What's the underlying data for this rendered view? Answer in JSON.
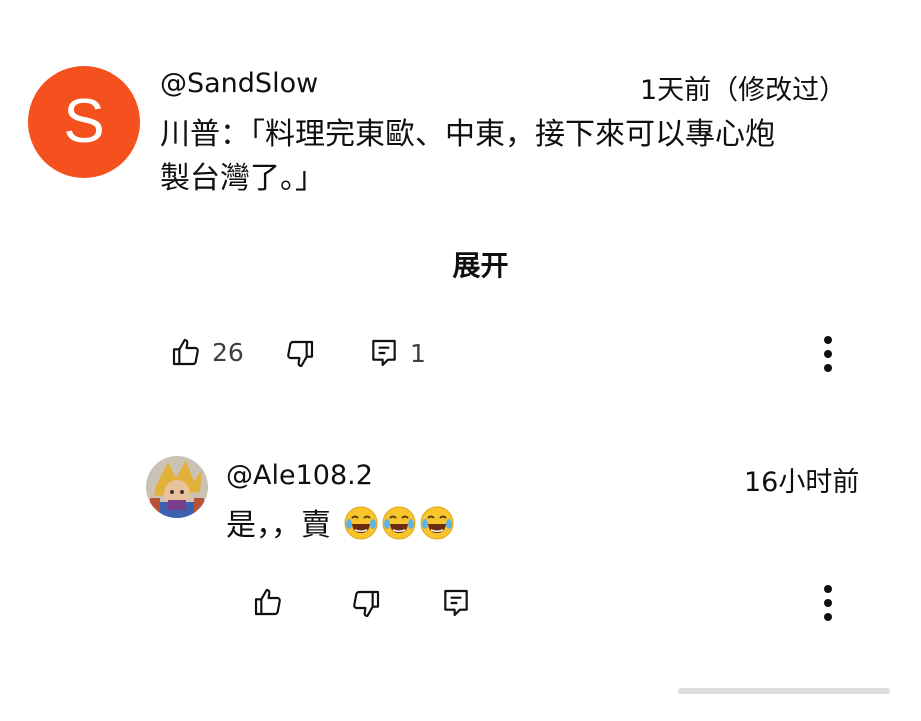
{
  "comment": {
    "avatar_letter": "S",
    "avatar_color": "#f4511e",
    "username": "@SandSlow",
    "timestamp": "1天前（修改过）",
    "text_line1": "川普：「料理完東歐、中東，接下來可以專心炮",
    "text_line2": "製台灣了。」",
    "expand_label": "展开",
    "likes": "26",
    "replies": "1"
  },
  "reply": {
    "username": "@Ale108.2",
    "timestamp": "16小时前",
    "text": "是，，賣",
    "emoji": "😂😂😂"
  },
  "icons": {
    "like": "thumbs-up-icon",
    "dislike": "thumbs-down-icon",
    "reply": "reply-comment-icon",
    "more": "more-vertical-icon"
  }
}
